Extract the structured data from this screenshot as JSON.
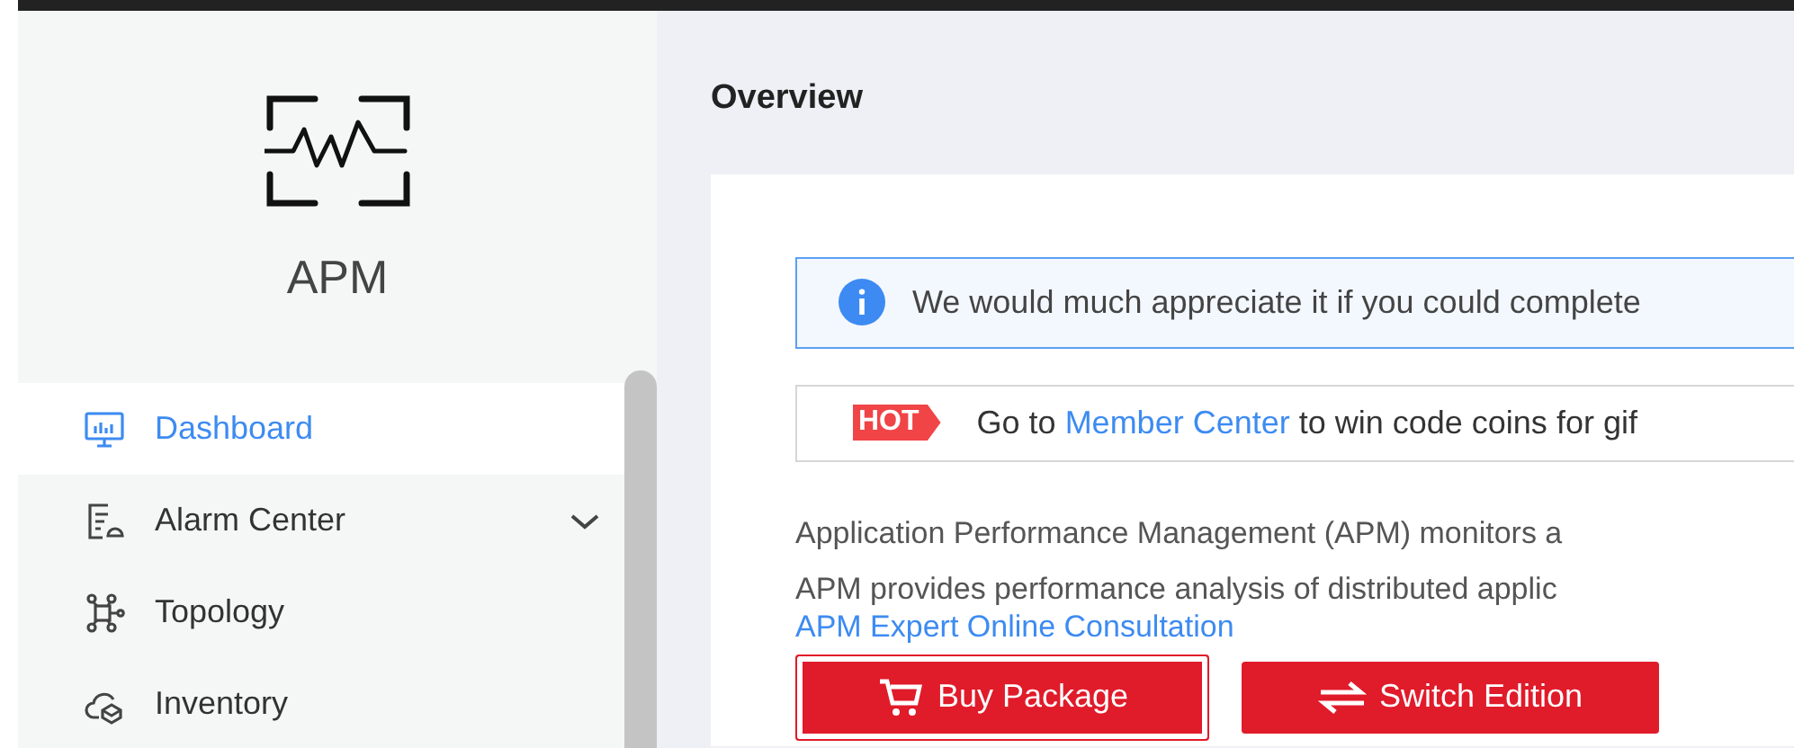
{
  "sidebar": {
    "product": "APM",
    "items": [
      {
        "label": "Dashboard",
        "selected": true
      },
      {
        "label": "Alarm Center",
        "selected": false,
        "expanded": false
      },
      {
        "label": "Topology",
        "selected": false
      },
      {
        "label": "Inventory",
        "selected": false
      }
    ]
  },
  "page_title": "Overview",
  "notice": {
    "text": "We would much appreciate it if you could complete"
  },
  "promo": {
    "badge": "HOT",
    "before": "Go to ",
    "link": "Member Center",
    "after": " to win code coins for gif"
  },
  "descriptions": [
    "Application Performance Management (APM) monitors a",
    "APM provides performance analysis of distributed applic"
  ],
  "consult_link": "APM Expert Online Consultation",
  "buttons": [
    {
      "label": "Buy Package",
      "focused": true
    },
    {
      "label": "Switch Edition",
      "focused": false
    }
  ]
}
